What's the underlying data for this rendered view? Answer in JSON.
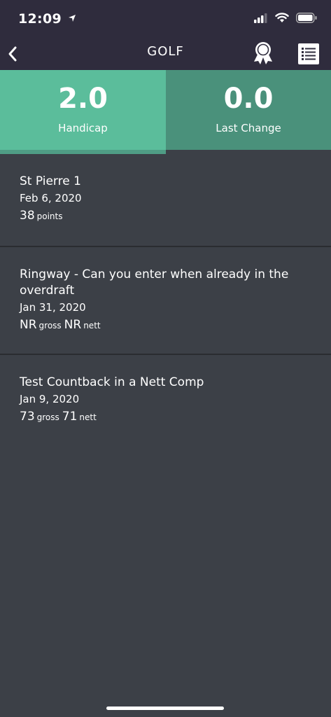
{
  "status_bar": {
    "time": "12:09"
  },
  "nav": {
    "title": "GOLF"
  },
  "stats": {
    "handicap": {
      "value": "2.0",
      "label": "Handicap"
    },
    "last_change": {
      "value": "0.0",
      "label": "Last Change"
    }
  },
  "rounds": [
    {
      "title": "St Pierre 1",
      "date": "Feb 6, 2020",
      "score1": "38",
      "unit1": "points"
    },
    {
      "title": "Ringway - Can you enter when already in the overdraft",
      "date": "Jan 31, 2020",
      "score1": "NR",
      "unit1": "gross",
      "score2": "NR",
      "unit2": "nett"
    },
    {
      "title": "Test Countback in a Nett Comp",
      "date": "Jan 9, 2020",
      "score1": "73",
      "unit1": "gross",
      "score2": "71",
      "unit2": "nett"
    }
  ]
}
